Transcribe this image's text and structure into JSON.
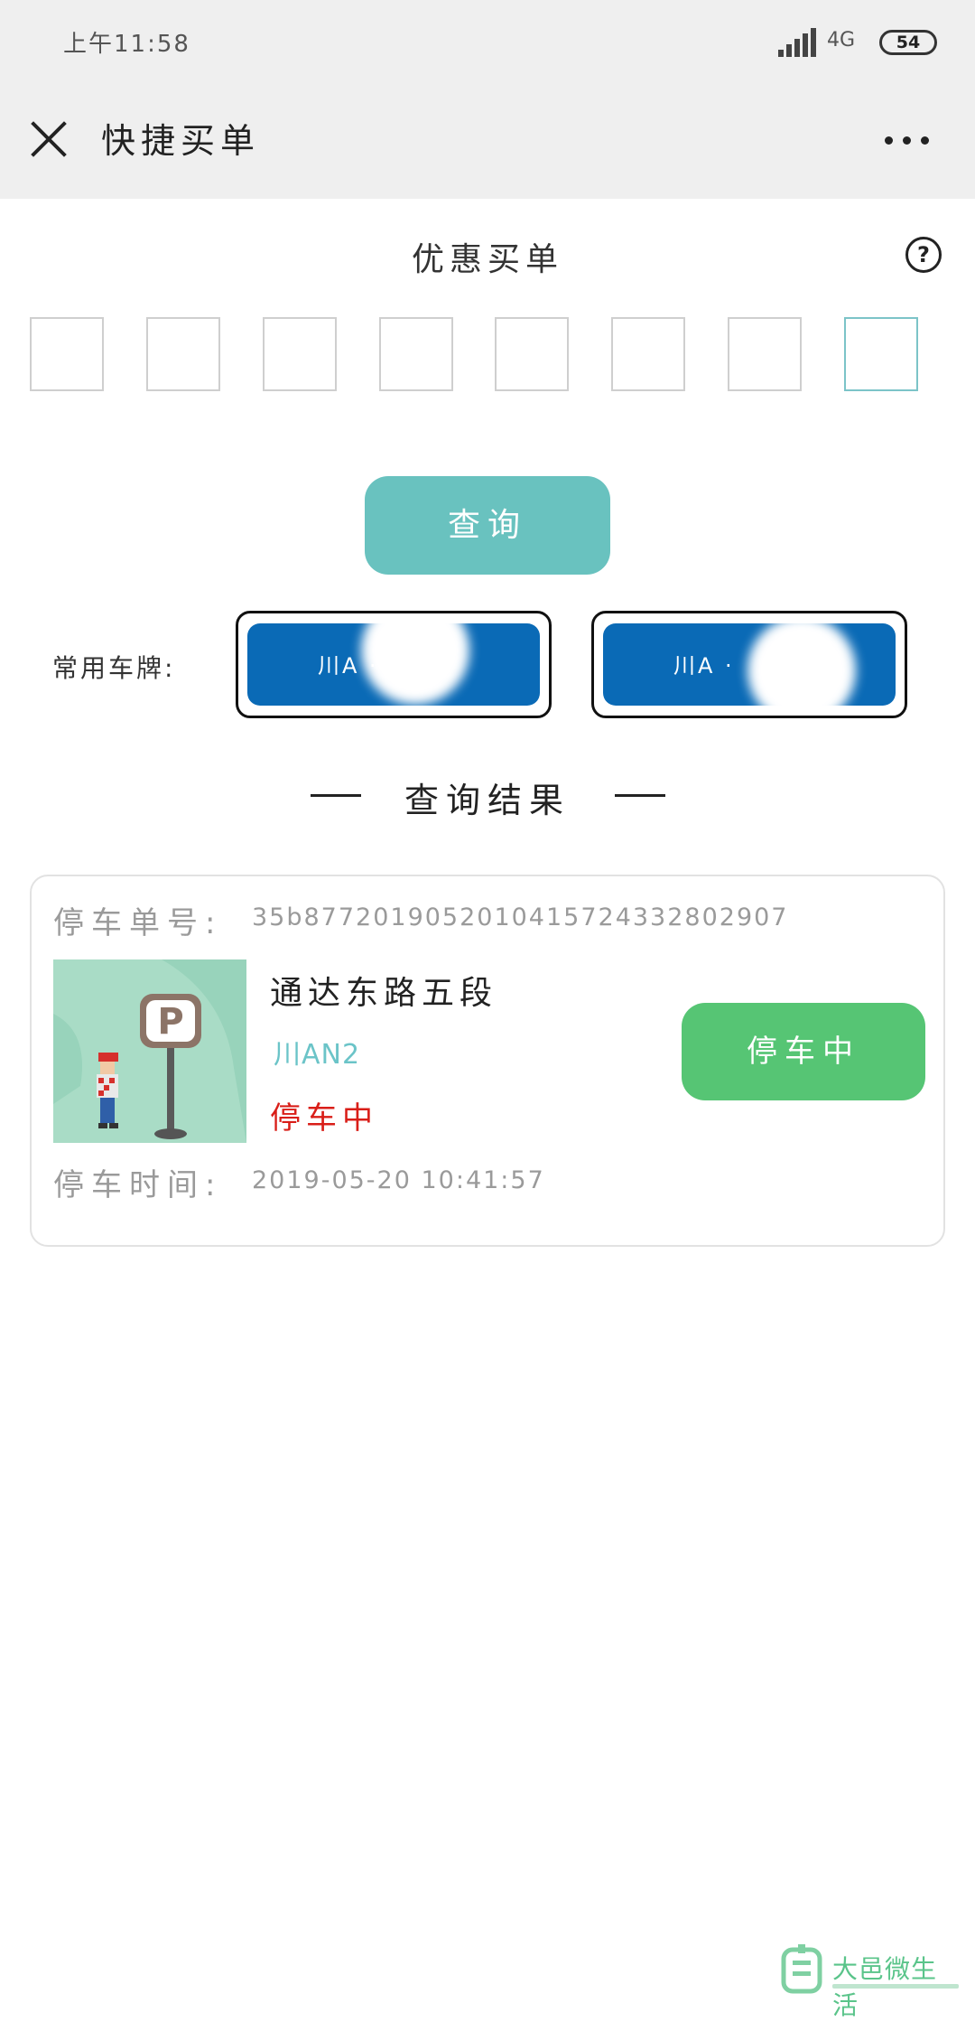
{
  "status_bar": {
    "time": "上午11:58",
    "network": "4G",
    "battery": "54"
  },
  "nav": {
    "title": "快捷买单"
  },
  "page": {
    "section_title": "优惠买单"
  },
  "query_button": "查询",
  "common_plates": {
    "label": "常用车牌:",
    "plates": [
      "川A ·",
      "川A ·"
    ]
  },
  "results": {
    "title": "查询结果",
    "order_label": "停车单号:",
    "order_number": "35b877201905201041572433280​2907",
    "place_name": "通达东路五段",
    "plate_number": "川AN2",
    "status_text": "停车中",
    "status_button": "停车中",
    "time_label": "停车时间:",
    "time_value": "2019-05-20  10:41:57",
    "sign_letter": "P"
  },
  "brand": {
    "name": "大邑微生活"
  },
  "colors": {
    "accent_teal": "#69c2bf",
    "plate_blue": "#0a6ab6",
    "status_green": "#56c574",
    "status_red": "#d91e18"
  }
}
